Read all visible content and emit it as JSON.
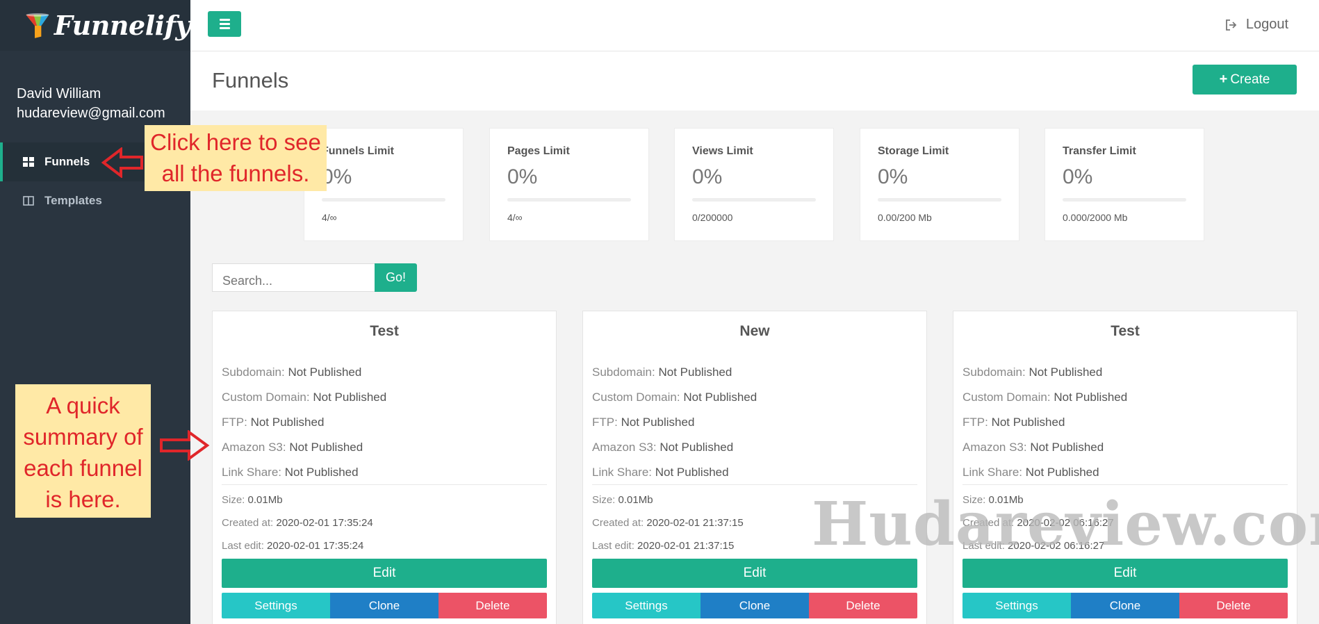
{
  "brand": {
    "name": "Funnelify"
  },
  "user": {
    "name": "David William",
    "email": "hudareview@gmail.com"
  },
  "sidebar": {
    "items": [
      {
        "label": "Funnels",
        "icon": "grid-icon",
        "active": true
      },
      {
        "label": "Templates",
        "icon": "columns-icon",
        "active": false
      }
    ]
  },
  "topbar": {
    "logout_label": "Logout"
  },
  "page": {
    "title": "Funnels",
    "create_label": "Create"
  },
  "stats": [
    {
      "label": "Funnels Limit",
      "percent": "0%",
      "detail": "4/∞",
      "fill": 0
    },
    {
      "label": "Pages Limit",
      "percent": "0%",
      "detail": "4/∞",
      "fill": 0
    },
    {
      "label": "Views Limit",
      "percent": "0%",
      "detail": "0/200000",
      "fill": 0
    },
    {
      "label": "Storage Limit",
      "percent": "0%",
      "detail": "0.00/200 Mb",
      "fill": 0
    },
    {
      "label": "Transfer Limit",
      "percent": "0%",
      "detail": "0.000/2000 Mb",
      "fill": 0
    }
  ],
  "search": {
    "placeholder": "Search...",
    "button_label": "Go!"
  },
  "field_labels": {
    "subdomain": "Subdomain:",
    "custom_domain": "Custom Domain:",
    "ftp": "FTP:",
    "amazon_s3": "Amazon S3:",
    "link_share": "Link Share:",
    "size": "Size:",
    "created": "Created at:",
    "last_edit": "Last edit:"
  },
  "card_buttons": {
    "edit": "Edit",
    "settings": "Settings",
    "clone": "Clone",
    "delete": "Delete"
  },
  "funnels": [
    {
      "title": "Test",
      "subdomain": "Not Published",
      "custom_domain": "Not Published",
      "ftp": "Not Published",
      "amazon_s3": "Not Published",
      "link_share": "Not Published",
      "size": "0.01Mb",
      "created": "2020-02-01 17:35:24",
      "last_edit": "2020-02-01 17:35:24"
    },
    {
      "title": "New",
      "subdomain": "Not Published",
      "custom_domain": "Not Published",
      "ftp": "Not Published",
      "amazon_s3": "Not Published",
      "link_share": "Not Published",
      "size": "0.01Mb",
      "created": "2020-02-01 21:37:15",
      "last_edit": "2020-02-01 21:37:15"
    },
    {
      "title": "Test",
      "subdomain": "Not Published",
      "custom_domain": "Not Published",
      "ftp": "Not Published",
      "amazon_s3": "Not Published",
      "link_share": "Not Published",
      "size": "0.01Mb",
      "created": "2020-02-02 06:16:27",
      "last_edit": "2020-02-02 06:16:27"
    }
  ],
  "annotations": {
    "sidebar_note": [
      "Click here to see",
      "all the funnels."
    ],
    "summary_note": [
      "A quick",
      "summary of",
      "each funnel",
      "is here."
    ]
  },
  "watermark": "Hudareview.com",
  "colors": {
    "accent": "#1eaf8c",
    "sidebar": "#2a3540",
    "settings": "#26c6c6",
    "clone": "#1f7fc6",
    "delete": "#ec5366",
    "annotation_text": "#e0262a",
    "annotation_bg": "#ffe9a6"
  }
}
